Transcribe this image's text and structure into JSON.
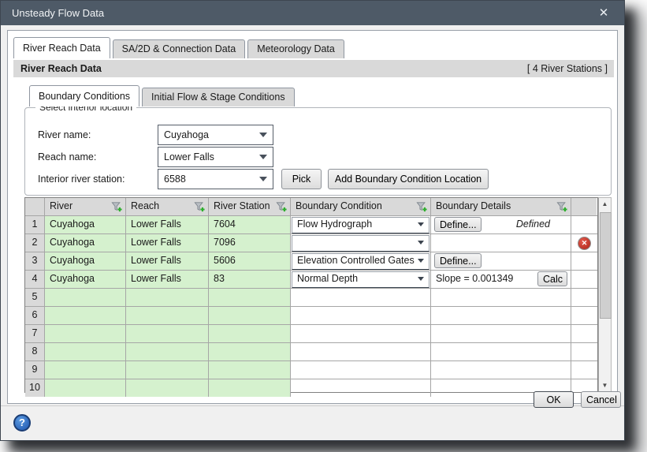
{
  "window": {
    "title": "Unsteady Flow Data",
    "close_glyph": "✕"
  },
  "main_tabs": [
    {
      "label": "River Reach Data",
      "active": true
    },
    {
      "label": "SA/2D & Connection Data",
      "active": false
    },
    {
      "label": "Meteorology Data",
      "active": false
    }
  ],
  "section_header": {
    "title": "River Reach Data",
    "badge": "[ 4 River Stations ]"
  },
  "sub_tabs": [
    {
      "label": "Boundary Conditions",
      "active": true
    },
    {
      "label": "Initial Flow & Stage Conditions",
      "active": false
    }
  ],
  "location_group": {
    "legend": "Select interior location",
    "fields": [
      {
        "label": "River name:",
        "value": "Cuyahoga"
      },
      {
        "label": "Reach name:",
        "value": "Lower Falls"
      },
      {
        "label": "Interior river station:",
        "value": "6588"
      }
    ],
    "pick_button": "Pick",
    "add_button": "Add Boundary Condition Location"
  },
  "table": {
    "columns": [
      "",
      "River",
      "Reach",
      "River Station",
      "Boundary Condition",
      "Boundary Details",
      ""
    ],
    "rows": [
      {
        "num": "1",
        "river": "Cuyahoga",
        "reach": "Lower Falls",
        "station": "7604",
        "boundary_condition": "Flow Hydrograph",
        "define_label": "Define...",
        "details_status": "Defined"
      },
      {
        "num": "2",
        "river": "Cuyahoga",
        "reach": "Lower Falls",
        "station": "7096",
        "boundary_condition": "",
        "error": true
      },
      {
        "num": "3",
        "river": "Cuyahoga",
        "reach": "Lower Falls",
        "station": "5606",
        "boundary_condition": "Elevation Controlled Gates",
        "define_label": "Define..."
      },
      {
        "num": "4",
        "river": "Cuyahoga",
        "reach": "Lower Falls",
        "station": "83",
        "boundary_condition": "Normal Depth",
        "slope_text": "Slope =  0.001349",
        "calc_label": "Calc"
      },
      {
        "num": "5"
      },
      {
        "num": "6"
      },
      {
        "num": "7"
      },
      {
        "num": "8"
      },
      {
        "num": "9"
      },
      {
        "num": "10"
      }
    ]
  },
  "footer": {
    "ok_label": "OK",
    "cancel_label": "Cancel",
    "help_glyph": "?"
  },
  "icons": {
    "filter": "funnel-plus-icon",
    "error": "red-x-circle-icon",
    "help": "question-circle-icon",
    "close": "close-icon"
  },
  "colors": {
    "titlebar": "#4e5a67",
    "tab_inactive": "#d9d9d9",
    "grid_green": "#d5f1ce",
    "error_red": "#ad2317",
    "help_blue": "#1d55ae"
  }
}
